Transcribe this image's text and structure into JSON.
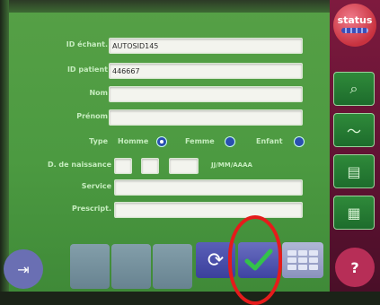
{
  "status": {
    "label": "status"
  },
  "form": {
    "id_sample": {
      "label": "ID échant.",
      "value": "AUTOSID145"
    },
    "id_patient": {
      "label": "ID patient",
      "value": "446667"
    },
    "nom": {
      "label": "Nom",
      "value": ""
    },
    "prenom": {
      "label": "Prénom",
      "value": ""
    },
    "type": {
      "label": "Type",
      "options": [
        "Homme",
        "Femme",
        "Enfant"
      ],
      "selected": "Homme"
    },
    "birthdate": {
      "label": "D. de naissance",
      "format": "JJ/MM/AAAA"
    },
    "service": {
      "label": "Service",
      "value": ""
    },
    "prescript": {
      "label": "Prescript.",
      "value": ""
    }
  },
  "icons": {
    "exit": "exit-icon",
    "refresh": "refresh-icon",
    "ok": "check-icon",
    "keyboard": "keyboard-icon",
    "help": "help-icon"
  },
  "colors": {
    "accent": "#e51b1b",
    "screen": "#56a046",
    "sidebar": "#7e1a3e"
  }
}
